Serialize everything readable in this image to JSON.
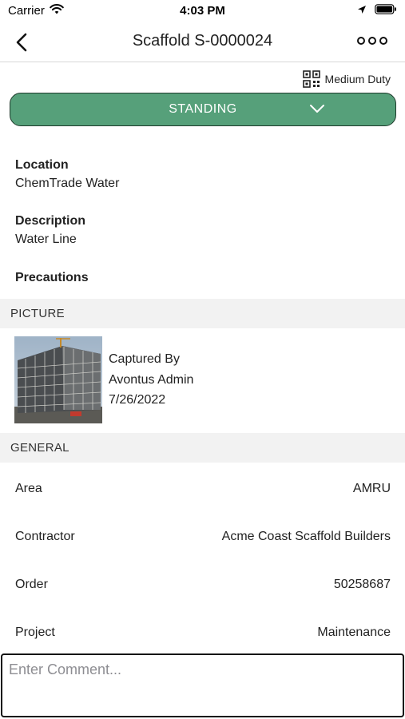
{
  "status_bar": {
    "carrier": "Carrier",
    "time": "4:03 PM",
    "icons": [
      "wifi-icon",
      "location-arrow-icon",
      "battery-icon"
    ]
  },
  "nav": {
    "title": "Scaffold S-0000024",
    "icons": [
      "chevron-left-icon",
      "more-icon"
    ]
  },
  "duty": {
    "label": "Medium Duty",
    "icon": "qr-code-icon"
  },
  "status_select": {
    "value": "STANDING",
    "color": "#56a07a",
    "icon": "chevron-down-icon"
  },
  "details": {
    "location_label": "Location",
    "location_value": "ChemTrade Water",
    "description_label": "Description",
    "description_value": "Water Line",
    "precautions_label": "Precautions"
  },
  "picture_section": {
    "header": "PICTURE",
    "captured_by_label": "Captured By",
    "captured_by_value": "Avontus Admin",
    "date": "7/26/2022"
  },
  "general_section": {
    "header": "GENERAL",
    "rows": [
      {
        "label": "Area",
        "value": "AMRU"
      },
      {
        "label": "Contractor",
        "value": "Acme Coast Scaffold Builders"
      },
      {
        "label": "Order",
        "value": "50258687"
      },
      {
        "label": "Project",
        "value": "Maintenance"
      }
    ]
  },
  "comment": {
    "placeholder": "Enter Comment..."
  }
}
